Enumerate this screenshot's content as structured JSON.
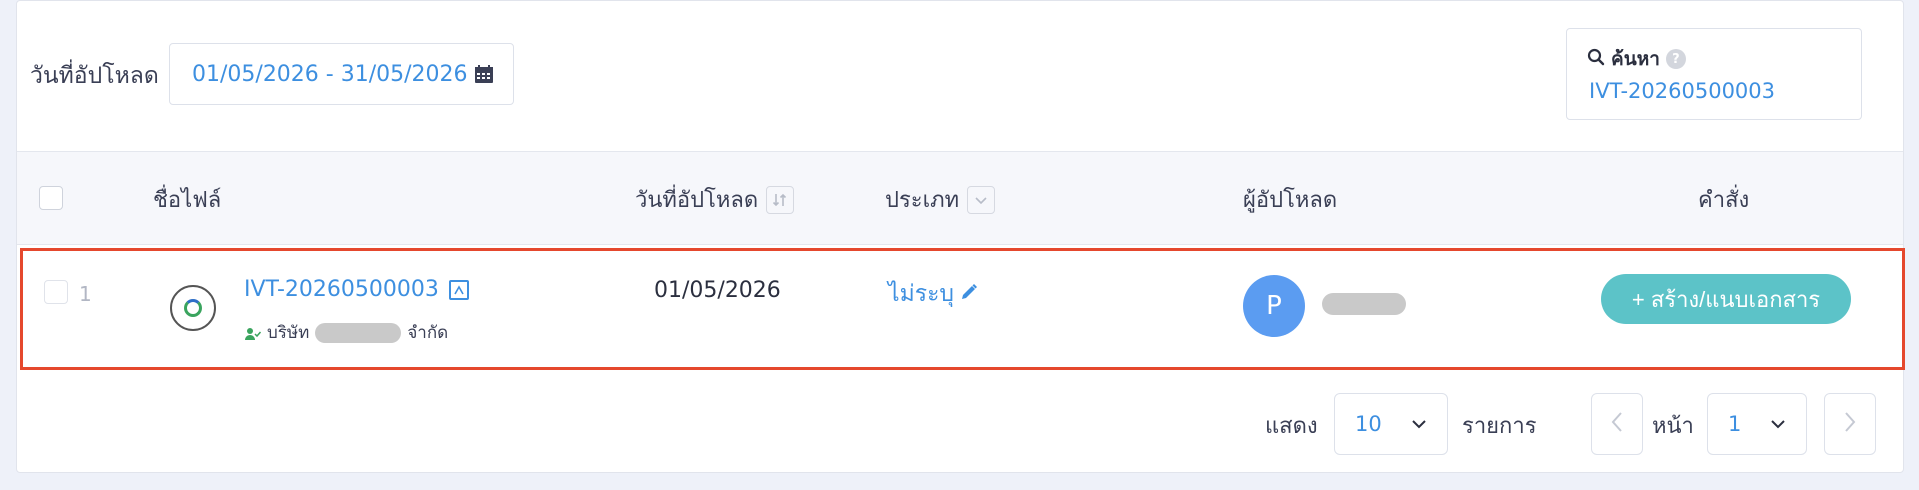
{
  "filters": {
    "date_label": "วันที่อัปโหลด",
    "date_range": "01/05/2026 - 31/05/2026",
    "search_label": "ค้นหา",
    "search_help": "?",
    "search_value": "IVT-20260500003"
  },
  "table": {
    "headers": {
      "file_name": "ชื่อไฟล์",
      "upload_date": "วันที่อัปโหลด",
      "type": "ประเภท",
      "uploader": "ผู้อัปโหลด",
      "actions": "คำสั่ง"
    },
    "rows": [
      {
        "index": "1",
        "file_name": "IVT-20260500003",
        "company_prefix": "บริษัท",
        "company_suffix": "จำกัด",
        "upload_date": "01/05/2026",
        "type": "ไม่ระบุ",
        "uploader_initial": "P",
        "action_label": "+ สร้าง/แนบเอกสาร"
      }
    ]
  },
  "pagination": {
    "show_label": "แสดง",
    "page_size": "10",
    "items_label": "รายการ",
    "page_label": "หน้า",
    "page": "1"
  },
  "colors": {
    "accent": "#3d8fe0",
    "button": "#5cc3c8",
    "avatar": "#5b9cf1",
    "highlight_border": "#e5482d"
  }
}
